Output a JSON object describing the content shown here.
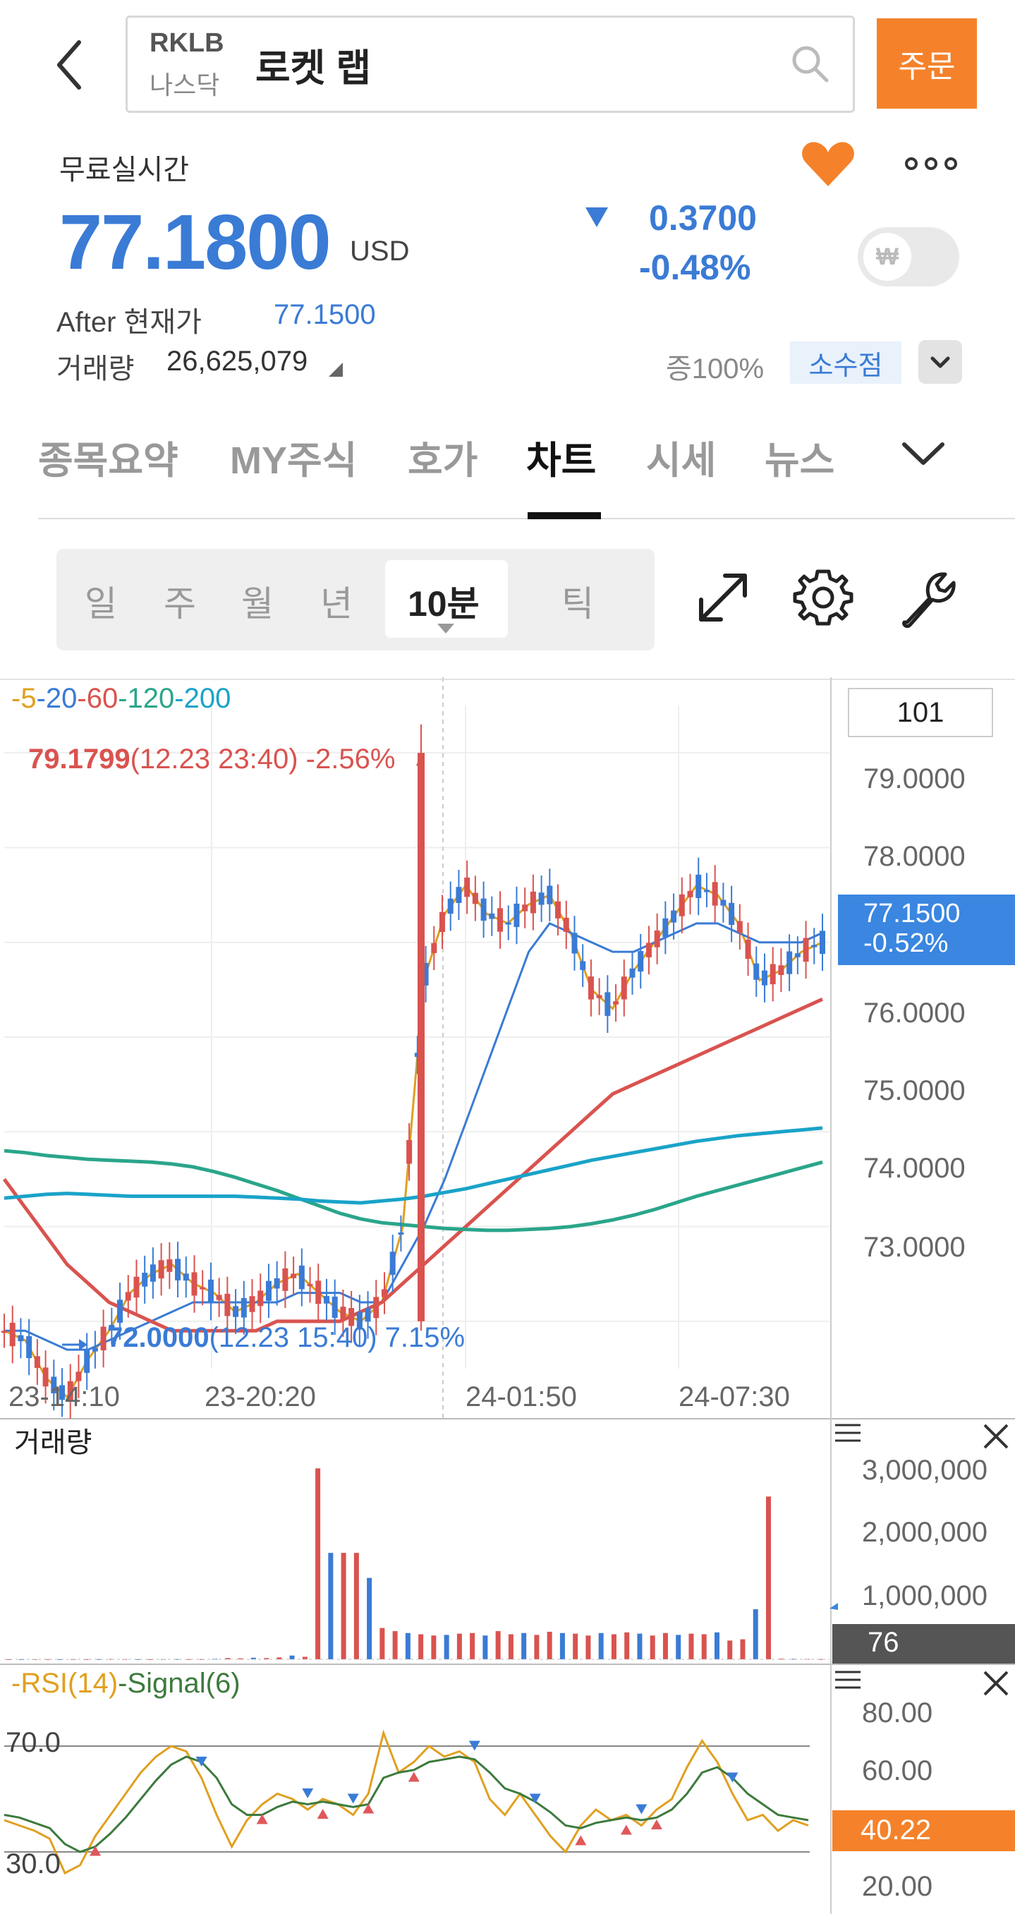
{
  "header": {
    "ticker": "RKLB",
    "exchange": "나스닥",
    "stock_name": "로켓 랩",
    "order_label": "주문"
  },
  "quote": {
    "realtime_label": "무료실시간",
    "price": "77.1800",
    "currency": "USD",
    "change_abs": "0.3700",
    "change_pct": "-0.48%",
    "after_label": "After 현재가",
    "after_price": "77.1500",
    "volume_label": "거래량",
    "volume_value": "26,625,079",
    "margin_label": "증100%",
    "fraction_label": "소수점",
    "toggle_symbol": "₩",
    "favorite": true
  },
  "tabs": [
    "종목요약",
    "MY주식",
    "호가",
    "차트",
    "시세",
    "뉴스"
  ],
  "active_tab": "차트",
  "periods": [
    "일",
    "주",
    "월",
    "년",
    "10분",
    "틱"
  ],
  "active_period": "10분",
  "chart_data": [
    {
      "type": "line",
      "panel": "price",
      "ma_legend": [
        "-5",
        "-20",
        "-60",
        "-120",
        "-200"
      ],
      "ma_colors": [
        "#e0a020",
        "#3a7bd5",
        "#d9534f",
        "#2aa58a",
        "#1aa3c8"
      ],
      "x": [
        "23-14:10",
        "23-20:20",
        "24-01:50",
        "24-07:30"
      ],
      "ylim": [
        72.5,
        79.5
      ],
      "y_ticks": [
        "79.0000",
        "78.0000",
        "77.0000",
        "76.0000",
        "75.0000",
        "74.0000",
        "73.0000"
      ],
      "page_count": "101",
      "last_price": "77.1500",
      "last_change": "-0.52%",
      "high_label": "79.1799",
      "high_detail": "(12.23 23:40) -2.56%",
      "low_label": "72.0000",
      "low_detail": "(12.23 15:40) 7.15%",
      "series": [
        {
          "name": "-5",
          "values": [
            72.9,
            72.8,
            72.4,
            72.2,
            72.6,
            72.9,
            73.3,
            73.5,
            73.6,
            73.4,
            73.3,
            73.1,
            73.2,
            73.4,
            73.5,
            73.3,
            73.1,
            73.0,
            73.2,
            74.0,
            76.6,
            77.3,
            77.6,
            77.3,
            77.2,
            77.4,
            77.5,
            77.1,
            76.5,
            76.3,
            76.7,
            77.0,
            77.3,
            77.6,
            77.5,
            77.2,
            76.6,
            76.7,
            76.9,
            77.0
          ]
        },
        {
          "name": "-20",
          "values": [
            72.9,
            72.9,
            72.8,
            72.7,
            72.7,
            72.8,
            72.9,
            73.0,
            73.1,
            73.2,
            73.2,
            73.2,
            73.2,
            73.2,
            73.3,
            73.3,
            73.3,
            73.2,
            73.2,
            73.6,
            74.0,
            74.5,
            75.1,
            75.7,
            76.3,
            76.9,
            77.2,
            77.1,
            77.0,
            76.9,
            76.9,
            77.0,
            77.1,
            77.2,
            77.2,
            77.1,
            77.0,
            77.0,
            77.0,
            77.1
          ]
        },
        {
          "name": "-60",
          "values": [
            74.5,
            74.2,
            73.9,
            73.6,
            73.4,
            73.2,
            73.1,
            73.0,
            72.9,
            72.9,
            72.9,
            72.9,
            72.9,
            73.0,
            73.0,
            73.0,
            73.0,
            73.1,
            73.2,
            73.4,
            73.6,
            73.8,
            74.0,
            74.2,
            74.4,
            74.6,
            74.8,
            75.0,
            75.2,
            75.4,
            75.5,
            75.6,
            75.7,
            75.8,
            75.9,
            76.0,
            76.1,
            76.2,
            76.3,
            76.4
          ]
        },
        {
          "name": "-120",
          "values": [
            74.8,
            74.78,
            74.75,
            74.73,
            74.71,
            74.7,
            74.69,
            74.68,
            74.66,
            74.63,
            74.58,
            74.52,
            74.45,
            74.38,
            74.3,
            74.22,
            74.14,
            74.08,
            74.04,
            74.02,
            74.0,
            73.98,
            73.97,
            73.96,
            73.96,
            73.97,
            73.98,
            74.0,
            74.03,
            74.07,
            74.12,
            74.18,
            74.25,
            74.32,
            74.38,
            74.44,
            74.5,
            74.56,
            74.62,
            74.68
          ]
        },
        {
          "name": "-200",
          "values": [
            74.3,
            74.32,
            74.34,
            74.35,
            74.34,
            74.33,
            74.32,
            74.32,
            74.32,
            74.32,
            74.32,
            74.32,
            74.31,
            74.3,
            74.29,
            74.27,
            74.26,
            74.25,
            74.27,
            74.29,
            74.32,
            74.36,
            74.4,
            74.45,
            74.5,
            74.55,
            74.6,
            74.65,
            74.7,
            74.74,
            74.78,
            74.82,
            74.86,
            74.9,
            74.93,
            74.96,
            74.98,
            75.0,
            75.02,
            75.04
          ]
        }
      ]
    },
    {
      "type": "bar",
      "panel": "volume",
      "title": "거래량",
      "y_ticks": [
        "3,000,000",
        "2,000,000",
        "1,000,000"
      ],
      "last_value": "76",
      "values": [
        2000,
        1500,
        3000,
        2500,
        1800,
        2200,
        2600,
        3000,
        5000,
        4000,
        3000,
        2000,
        5000,
        4000,
        3500,
        3000,
        8000,
        20000,
        15000,
        25000,
        20000,
        30000,
        60000,
        40000,
        3050000,
        1700000,
        1700000,
        1700000,
        1300000,
        500000,
        450000,
        420000,
        400000,
        380000,
        390000,
        410000,
        420000,
        380000,
        450000,
        400000,
        420000,
        390000,
        440000,
        420000,
        410000,
        380000,
        420000,
        400000,
        430000,
        410000,
        380000,
        420000,
        390000,
        410000,
        400000,
        430000,
        300000,
        320000,
        800000,
        2600000,
        10000,
        8000,
        6000,
        5000
      ]
    },
    {
      "type": "line",
      "panel": "rsi",
      "legend": [
        "-RSI(14)",
        "-Signal(6)"
      ],
      "y_ticks": [
        "80.00",
        "60.00",
        "20.00"
      ],
      "ref_lines": [
        "70.0",
        "30.0"
      ],
      "last_value": "40.22",
      "series": [
        {
          "name": "-RSI(14)",
          "values": [
            42,
            40,
            38,
            35,
            22,
            25,
            36,
            44,
            52,
            60,
            66,
            70,
            68,
            58,
            44,
            32,
            42,
            48,
            52,
            50,
            46,
            50,
            48,
            44,
            52,
            75,
            60,
            64,
            70,
            66,
            68,
            64,
            50,
            44,
            52,
            44,
            36,
            30,
            40,
            46,
            42,
            44,
            40,
            46,
            50,
            62,
            72,
            64,
            52,
            42,
            44,
            38,
            42,
            40
          ]
        },
        {
          "name": "-Signal(6)",
          "values": [
            44,
            43,
            41,
            39,
            33,
            30,
            32,
            37,
            43,
            50,
            57,
            63,
            66,
            64,
            58,
            48,
            44,
            44,
            47,
            49,
            48,
            49,
            48,
            47,
            48,
            58,
            60,
            61,
            64,
            65,
            66,
            65,
            60,
            54,
            52,
            49,
            45,
            40,
            39,
            41,
            42,
            43,
            42,
            43,
            46,
            52,
            60,
            62,
            58,
            52,
            48,
            44,
            43,
            42
          ]
        }
      ]
    }
  ]
}
